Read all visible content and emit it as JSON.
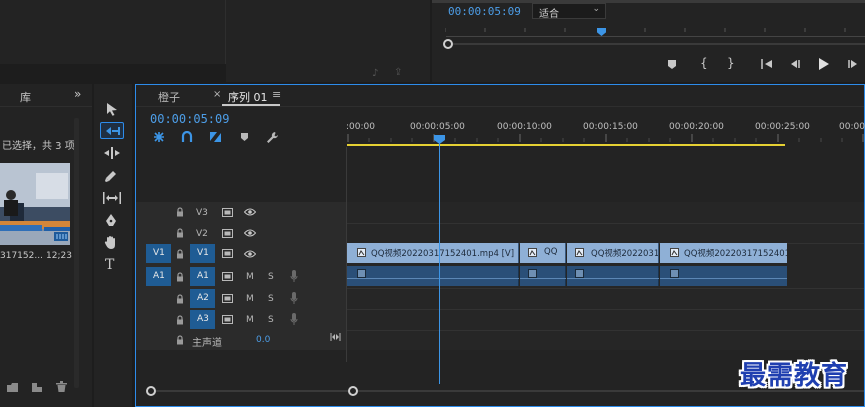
{
  "program": {
    "timecode": "00:00:05:09",
    "fit_label": "适合",
    "transport": {
      "marker": "marker-icon",
      "in": "{",
      "out": "}",
      "goto_in": "goto-in-icon",
      "step_back": "step-back-icon",
      "play": "play-icon",
      "step_forward": "step-forward-icon"
    }
  },
  "project": {
    "tab_label": "库",
    "selection_text": "已选择，共 3 项",
    "clip_name": "317152...",
    "clip_duration": "12;23"
  },
  "timeline": {
    "tab_orange": "橙子",
    "tab_sequence": "序列 01",
    "timecode": "00:00:05:09",
    "ruler": [
      ":00:00",
      "00:00:05:00",
      "00:00:10:00",
      "00:00:15:00",
      "00:00:20:00",
      "00:00:25:00",
      "00:00"
    ],
    "tracks": {
      "v3": "V3",
      "v2": "V2",
      "v1": "V1",
      "v1_src": "V1",
      "a1": "A1",
      "a1_src": "A1",
      "a2": "A2",
      "a3": "A3",
      "mute": "M",
      "solo": "S",
      "master": "主声道",
      "master_value": "0.0"
    },
    "clips": [
      "QQ视频20220317152401.mp4 [V]",
      "QQ",
      "QQ视频20220317",
      "QQ视频20220317152401.m"
    ]
  },
  "watermark": "最需教育",
  "colors": {
    "accent": "#2d8ceb",
    "video_clip": "#8fb0d6",
    "audio_clip": "#2a4f78",
    "playhead": "#3c95e6",
    "workarea": "#e5d033"
  }
}
